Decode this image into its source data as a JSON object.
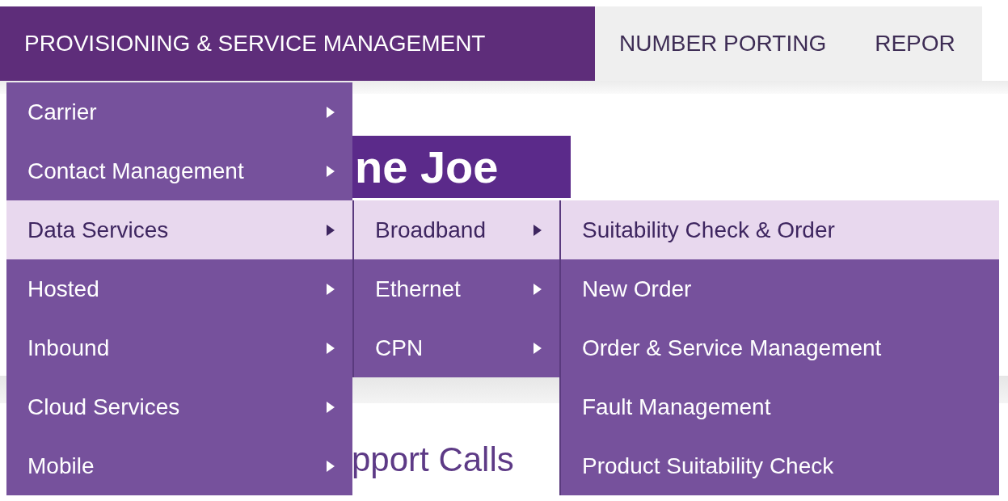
{
  "nav": {
    "items": [
      {
        "label": "PROVISIONING & SERVICE MANAGEMENT",
        "selected": true
      },
      {
        "label": "NUMBER PORTING",
        "selected": false
      },
      {
        "label": "REPOR",
        "selected": false
      }
    ]
  },
  "page": {
    "banner": "ne Joe",
    "heading": "pport Calls"
  },
  "menu": {
    "items": [
      {
        "label": "Carrier",
        "submenu": true,
        "selected": false
      },
      {
        "label": "Contact Management",
        "submenu": true,
        "selected": false
      },
      {
        "label": "Data Services",
        "submenu": true,
        "selected": true,
        "children": [
          {
            "label": "Broadband",
            "submenu": true,
            "selected": true,
            "children": [
              {
                "label": "Suitability Check & Order",
                "submenu": false,
                "selected": true
              },
              {
                "label": "New Order",
                "submenu": false,
                "selected": false
              },
              {
                "label": "Order & Service Management",
                "submenu": false,
                "selected": false
              },
              {
                "label": "Fault Management",
                "submenu": false,
                "selected": false
              },
              {
                "label": "Product Suitability Check",
                "submenu": false,
                "selected": false
              }
            ]
          },
          {
            "label": "Ethernet",
            "submenu": true,
            "selected": false
          },
          {
            "label": "CPN",
            "submenu": true,
            "selected": false
          }
        ]
      },
      {
        "label": "Hosted",
        "submenu": true,
        "selected": false
      },
      {
        "label": "Inbound",
        "submenu": true,
        "selected": false
      },
      {
        "label": "Cloud Services",
        "submenu": true,
        "selected": false
      },
      {
        "label": "Mobile",
        "submenu": true,
        "selected": false
      }
    ]
  }
}
